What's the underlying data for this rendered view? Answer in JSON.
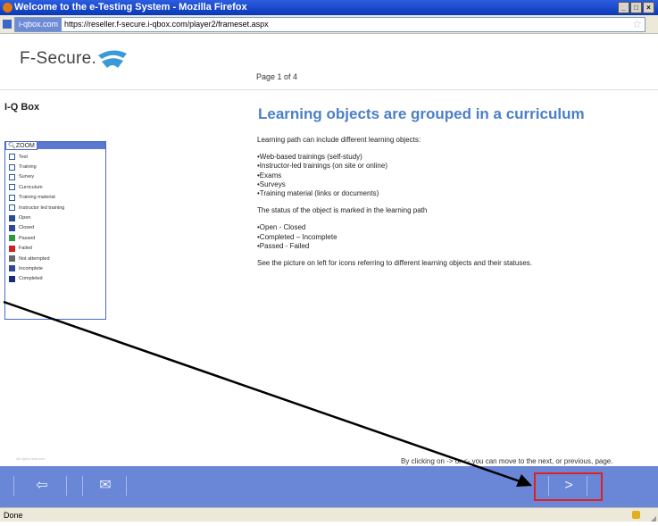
{
  "window": {
    "title": "Welcome to the e-Testing System - Mozilla Firefox",
    "minimize": "_",
    "maximize": "□",
    "close": "×"
  },
  "urlbar": {
    "domain": "i-qbox.com",
    "url": "https://reseller.f-secure.i-qbox.com/player2/frameset.aspx"
  },
  "header": {
    "logo": "F-Secure.",
    "page_info": "Page 1 of 4"
  },
  "course": {
    "title": "I-Q Box"
  },
  "legend": {
    "zoom_label": "ZOOM",
    "items": [
      {
        "label": "Test",
        "icon": "test-icon",
        "color": "#2d5a9a"
      },
      {
        "label": "Training",
        "icon": "training-icon",
        "color": "#2d5a9a"
      },
      {
        "label": "Survey",
        "icon": "survey-icon",
        "color": "#2d5a9a"
      },
      {
        "label": "Curriculum",
        "icon": "curriculum-icon",
        "color": "#2d5a9a"
      },
      {
        "label": "Training material",
        "icon": "training-material-icon",
        "color": "#2d5a9a"
      },
      {
        "label": "Instructor led training",
        "icon": "instructor-led-training-icon",
        "color": "#2d5a9a"
      },
      {
        "label": "Open",
        "icon": "open-icon",
        "color": "#2d4a9a"
      },
      {
        "label": "Closed",
        "icon": "closed-icon",
        "color": "#2d4a9a"
      },
      {
        "label": "Passed",
        "icon": "passed-icon",
        "color": "#2a9a3a"
      },
      {
        "label": "Failed",
        "icon": "failed-icon",
        "color": "#d02020"
      },
      {
        "label": "Not attempted",
        "icon": "not-attempted-icon",
        "color": "#666666"
      },
      {
        "label": "Incomplete",
        "icon": "incomplete-icon",
        "color": "#2d4a9a"
      },
      {
        "label": "Completed",
        "icon": "completed-icon",
        "color": "#1a2a7a"
      }
    ]
  },
  "main": {
    "headline": "Learning objects are grouped in a curriculum",
    "intro": "Learning path can include different learning objects:",
    "object_types": [
      "•Web-based trainings (self-study)",
      "•Instructor-led trainings (on site or online)",
      "•Exams",
      "•Surveys",
      "•Training material (links or documents)"
    ],
    "status_intro": "The status of the object is marked in the learning path",
    "statuses": [
      "•Open - Closed",
      "•Completed – Incomplete",
      "•Passed - Failed"
    ],
    "closing": "See the picture on left for icons referring to different learning objects and their statuses."
  },
  "footer": {
    "note": "By clicking on -> or <- you can move to the next, or previous, page.",
    "small_text": "All rights reserved"
  },
  "nav": {
    "exit_icon": "⇦",
    "mail_icon": "✉",
    "next_label": ">"
  },
  "status": {
    "text": "Done"
  },
  "colors": {
    "titlebar": "#0a38b8",
    "navbar": "#6a86d6",
    "headline": "#4a7fc7",
    "highlight": "#e02020"
  }
}
